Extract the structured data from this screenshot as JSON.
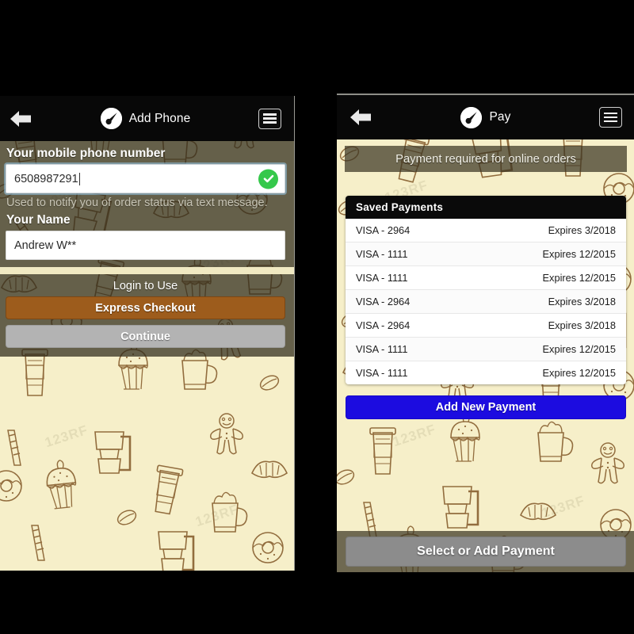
{
  "left_screen": {
    "nav": {
      "back_icon": "back-arrow-icon",
      "logo_icon": "brand-coffee-logo-icon",
      "title": "Add Phone",
      "menu_icon": "hamburger-menu-icon"
    },
    "phone_field": {
      "label": "Your mobile phone number",
      "value": "6508987291",
      "placeholder": "Mobile phone number",
      "valid_icon": "checkmark-circle-icon",
      "help": "Used to notify you of order status via text message."
    },
    "name_field": {
      "label": "Your Name",
      "value": "Andrew W**",
      "placeholder": "Your Name"
    },
    "actions": {
      "title": "Login to Use",
      "express_label": "Express Checkout",
      "continue_label": "Continue",
      "express_color": "#9d5c1c",
      "continue_color": "#b3b3b3"
    }
  },
  "right_screen": {
    "nav": {
      "back_icon": "back-arrow-icon",
      "logo_icon": "brand-coffee-logo-icon",
      "title": "Pay",
      "menu_icon": "hamburger-menu-icon"
    },
    "banner": "Payment required for online orders",
    "card": {
      "header": "Saved Payments",
      "rows": [
        {
          "name": "VISA - 2964",
          "expires": "Expires 3/2018"
        },
        {
          "name": "VISA - 1111",
          "expires": "Expires 12/2015"
        },
        {
          "name": "VISA - 1111",
          "expires": "Expires 12/2015"
        },
        {
          "name": "VISA - 2964",
          "expires": "Expires 3/2018"
        },
        {
          "name": "VISA - 2964",
          "expires": "Expires 3/2018"
        },
        {
          "name": "VISA - 1111",
          "expires": "Expires 12/2015"
        },
        {
          "name": "VISA - 1111",
          "expires": "Expires 12/2015"
        }
      ]
    },
    "add_payment_label": "Add New Payment",
    "add_payment_color": "#1c0ce0",
    "footer_label": "Select or Add Payment",
    "footer_color": "#8c8c8c"
  },
  "watermark": "123RF",
  "theme": {
    "background": "#f6efc9",
    "doodle_ink": "#8a6233",
    "navbar": "#080808",
    "overlay": "rgba(47,43,28,0.73)",
    "success": "#35c84b"
  }
}
